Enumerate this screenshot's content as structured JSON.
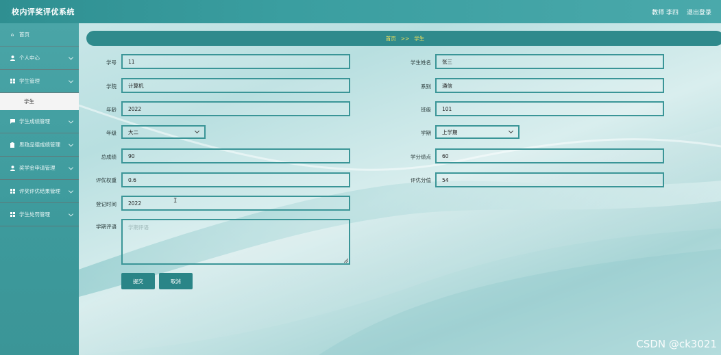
{
  "header": {
    "app_title": "校内评奖评优系统",
    "user_role": "教师 李四",
    "logout": "退出登录"
  },
  "sidebar": {
    "items": [
      {
        "label": "首页",
        "icon": "home-icon"
      },
      {
        "label": "个人中心",
        "icon": "user-icon"
      },
      {
        "label": "学生管理",
        "icon": "grid-icon"
      },
      {
        "label": "学生成绩管理",
        "icon": "comment-icon"
      },
      {
        "label": "思政品德成绩管理",
        "icon": "clipboard-icon"
      },
      {
        "label": "奖学金申请管理",
        "icon": "user-icon"
      },
      {
        "label": "评奖评优结果管理",
        "icon": "grid-icon"
      },
      {
        "label": "学生处罚管理",
        "icon": "grid-icon"
      }
    ],
    "sub_item": "学生"
  },
  "breadcrumb": {
    "home": "首页",
    "separator": ">>",
    "current": "学生"
  },
  "form": {
    "student_id": {
      "label": "学号",
      "value": "11"
    },
    "student_name": {
      "label": "学生姓名",
      "value": "张三"
    },
    "college": {
      "label": "学院",
      "value": "计算机"
    },
    "department": {
      "label": "系别",
      "value": "通信"
    },
    "age": {
      "label": "年龄",
      "value": "2022"
    },
    "class": {
      "label": "班级",
      "value": "101"
    },
    "grade": {
      "label": "年级",
      "value": "大二"
    },
    "semester": {
      "label": "学期",
      "value": "上学期"
    },
    "total_score": {
      "label": "总成绩",
      "value": "90"
    },
    "gpa": {
      "label": "学分绩点",
      "value": "60"
    },
    "weight": {
      "label": "评优权重",
      "value": "0.6"
    },
    "score_value": {
      "label": "评优分值",
      "value": "54"
    },
    "register_time": {
      "label": "登记时间",
      "value": "2022"
    },
    "comment": {
      "label": "学期评语",
      "placeholder": "学期评语"
    }
  },
  "buttons": {
    "submit": "提交",
    "cancel": "取消"
  },
  "watermark": "CSDN @ck3021",
  "colors": {
    "header": "#3a9ea0",
    "sidebar": "#4aa5a7",
    "breadcrumb": "#2f8a8c",
    "breadcrumb_text": "#f5e35a",
    "border": "#3a9597",
    "button": "#2a8587"
  }
}
